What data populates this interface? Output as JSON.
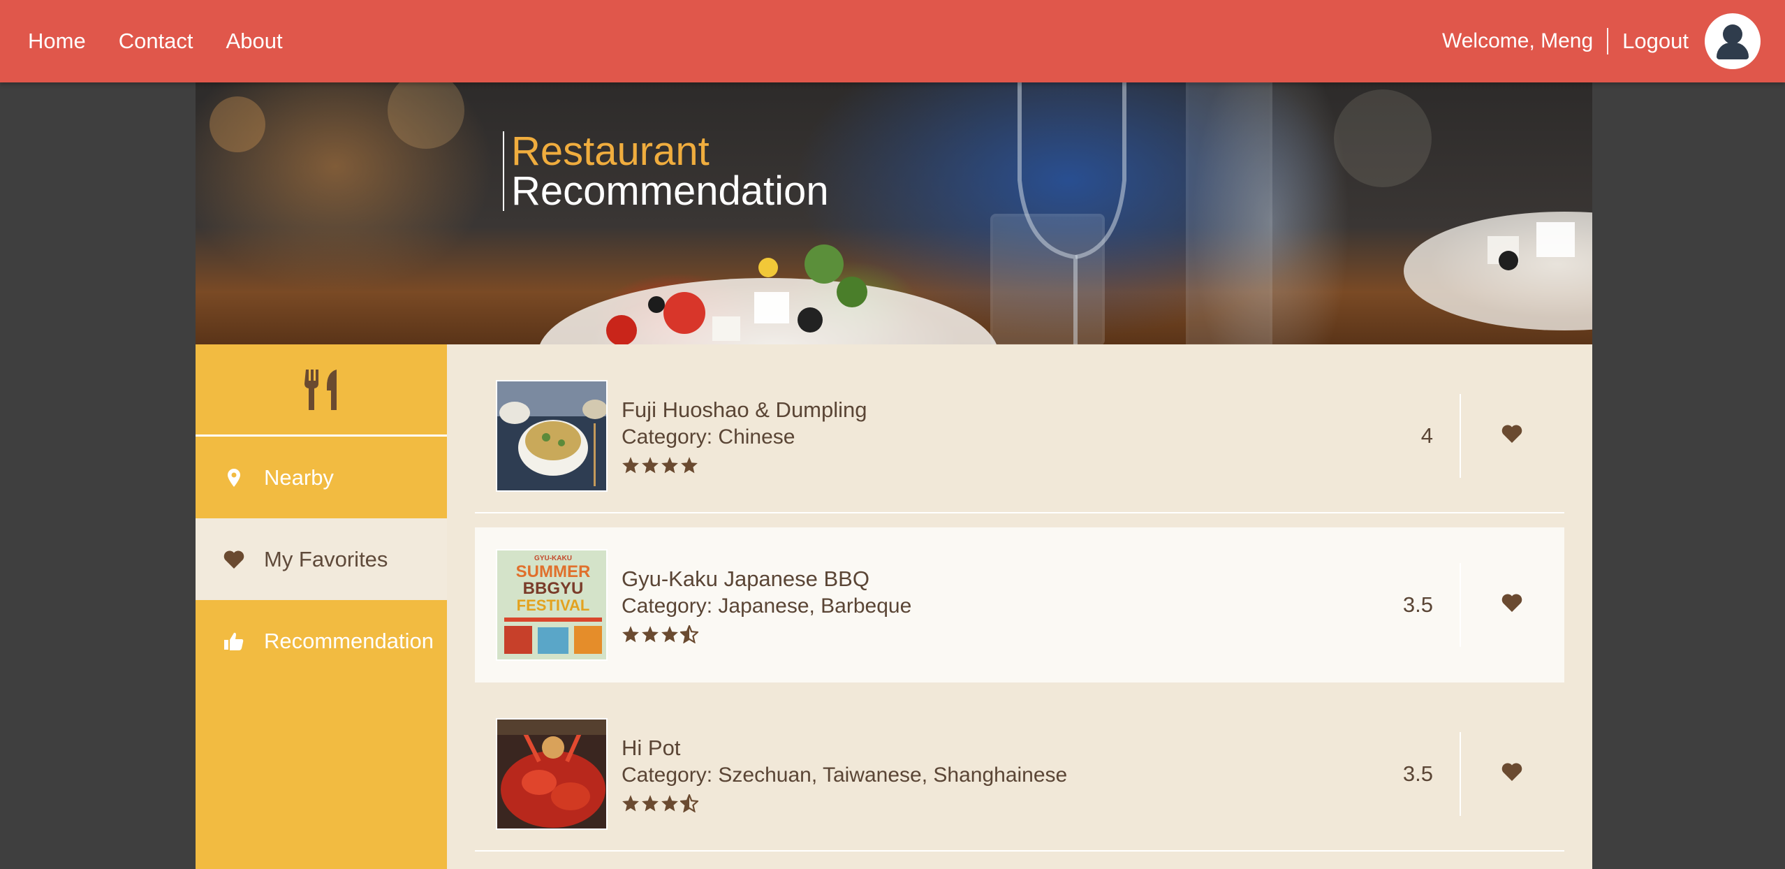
{
  "nav": {
    "links": [
      "Home",
      "Contact",
      "About"
    ],
    "welcome": "Welcome, Meng",
    "logout": "Logout"
  },
  "banner": {
    "line1": "Restaurant",
    "line2": "Recommendation"
  },
  "sidebar": {
    "top_icon": "fork-knife-icon",
    "items": [
      {
        "label": "Nearby",
        "icon": "map-pin-icon"
      },
      {
        "label": "My Favorites",
        "icon": "heart-icon"
      },
      {
        "label": "Recommendation",
        "icon": "thumbs-up-icon"
      }
    ],
    "active_item": "My Favorites"
  },
  "restaurants": [
    {
      "name": "Fuji Huoshao & Dumpling",
      "category": "Category: Chinese",
      "rating": "4",
      "stars": 4
    },
    {
      "name": "Gyu-Kaku Japanese BBQ",
      "category": "Category: Japanese, Barbeque",
      "rating": "3.5",
      "stars": 3.5
    },
    {
      "name": "Hi Pot",
      "category": "Category: Szechuan, Taiwanese, Shanghainese",
      "rating": "3.5",
      "stars": 3.5
    }
  ],
  "thumb2_text": {
    "top": "GYU-KAKU",
    "l1": "SUMMER",
    "l2": "BBGYU",
    "l3": "FESTIVAL"
  },
  "colors": {
    "nav_bg": "#e0574b",
    "sidebar_bg": "#f2bb41",
    "main_bg": "#f1e8d8",
    "accent_brown": "#5a4535",
    "banner_orange": "#f0ad3e"
  }
}
